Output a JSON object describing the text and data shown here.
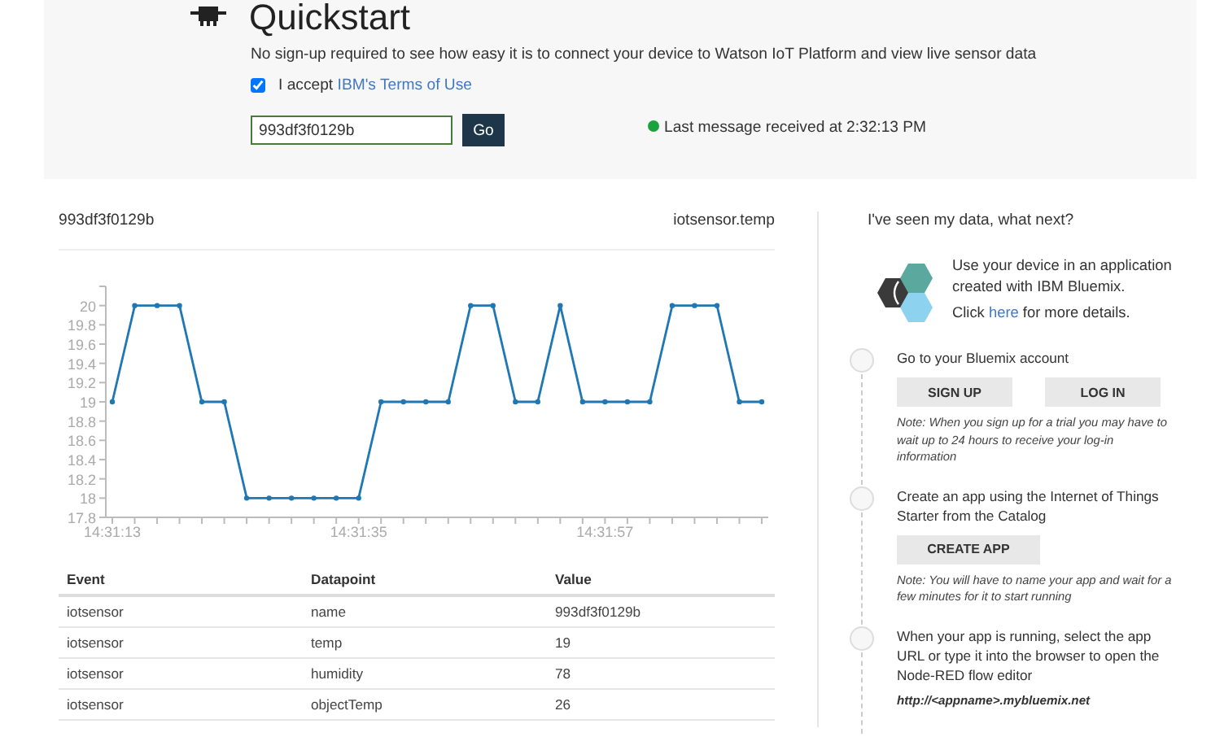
{
  "header": {
    "title": "Quickstart",
    "subtitle": "No sign-up required to see how easy it is to connect your device to Watson IoT Platform and view live sensor data",
    "terms": {
      "checked": true,
      "text": "I accept ",
      "link": "IBM's Terms of Use"
    },
    "device_id": "993df3f0129b",
    "go_button": "Go",
    "status": "Last message received at 2:32:13 PM"
  },
  "panel": {
    "device": "993df3f0129b",
    "datapoint": "iotsensor.temp",
    "chart_data": {
      "type": "line",
      "categories": [
        "14:31:13",
        null,
        null,
        null,
        null,
        null,
        null,
        null,
        null,
        null,
        null,
        "14:31:35",
        null,
        null,
        null,
        null,
        null,
        null,
        null,
        null,
        null,
        null,
        "14:31:57",
        null,
        null,
        null,
        null,
        null,
        null,
        null
      ],
      "series": [
        {
          "color": "#1f77b4",
          "marker": true,
          "values": [
            19,
            20,
            20,
            20,
            19,
            19,
            18,
            18,
            18,
            18,
            18,
            18,
            19,
            19,
            19,
            19,
            20,
            20,
            19,
            19,
            20,
            19,
            19,
            19,
            19,
            20,
            20,
            20,
            19,
            19
          ]
        }
      ],
      "ylim": [
        17.8,
        20.2
      ],
      "yticks": [
        17.8,
        18,
        18.2,
        18.4,
        18.6,
        18.8,
        19,
        19.2,
        19.4,
        19.6,
        19.8,
        20
      ]
    }
  },
  "table": {
    "columns": [
      "Event",
      "Datapoint",
      "Value"
    ],
    "rows": [
      [
        "iotsensor",
        "name",
        "993df3f0129b"
      ],
      [
        "iotsensor",
        "temp",
        "19"
      ],
      [
        "iotsensor",
        "humidity",
        "78"
      ],
      [
        "iotsensor",
        "objectTemp",
        "26"
      ]
    ]
  },
  "next": {
    "title": "I've seen my data, what next?",
    "intro": "Use your device in an application created with IBM Bluemix.",
    "click": {
      "before": "Click ",
      "link": "here",
      "after": " for more details."
    },
    "steps": [
      {
        "text": "Go to your Bluemix account",
        "buttons": [
          "SIGN UP",
          "LOG IN"
        ],
        "note": "Note: When you sign up for a trial you may have to wait up to 24 hours to receive your log-in information"
      },
      {
        "text": "Create an app using the Internet of Things Starter from the Catalog",
        "buttons": [
          "CREATE APP"
        ],
        "note": "Note: You will have to name your app and wait for a few minutes for it to start running"
      },
      {
        "text": "When your app is running, select the app URL or type it into the browser to open the Node-RED flow editor",
        "url": "http://<appname>.mybluemix.net"
      }
    ]
  }
}
